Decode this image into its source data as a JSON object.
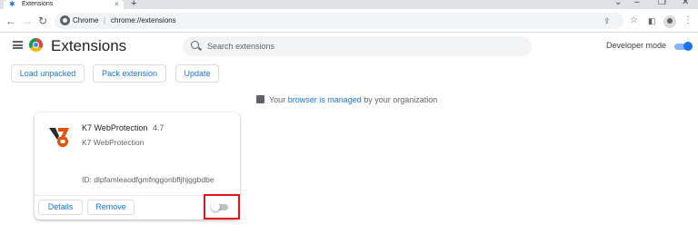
{
  "browser": {
    "tab_title": "Extensions",
    "tab_close": "×",
    "new_tab": "+",
    "window_controls": [
      "⌄",
      "–",
      "❐",
      "✕"
    ],
    "omnibox_site": "Chrome",
    "omnibox_sep": "|",
    "omnibox_url": "chrome://extensions"
  },
  "header": {
    "title": "Extensions",
    "search_placeholder": "Search extensions",
    "developer_mode_label": "Developer mode",
    "developer_mode_on": true
  },
  "actions": {
    "load_unpacked": "Load unpacked",
    "pack_extension": "Pack extension",
    "update": "Update"
  },
  "managed_notice": {
    "prefix": "Your",
    "link": "browser is managed",
    "suffix": "by your organization"
  },
  "extension": {
    "name": "K7 WebProtection",
    "version": "4.7",
    "description": "K7 WebProtection",
    "id_text": "ID: dlpfamleaodfgmfnggonbfljhjggbdbe",
    "details_label": "Details",
    "remove_label": "Remove",
    "enabled": false
  },
  "colors": {
    "accent": "#1a73e8",
    "highlight_box": "#e8141c",
    "k7_orange": "#e35205"
  }
}
